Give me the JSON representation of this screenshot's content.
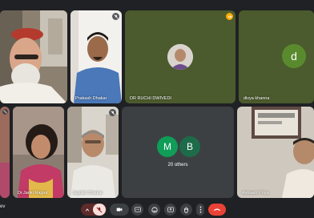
{
  "meeting": {
    "clock_partial": "ev"
  },
  "participants": [
    {
      "id": "p1",
      "name": ""
    },
    {
      "id": "p2",
      "name": "Prakash Dhakar"
    },
    {
      "id": "p3",
      "name": "DR RUCHI DWIVEDI"
    },
    {
      "id": "p4",
      "name": "divya khanna",
      "initial": "d"
    },
    {
      "id": "p5",
      "name": ""
    },
    {
      "id": "p6",
      "name": "Dr.Janki Rajput"
    },
    {
      "id": "p7",
      "name": "Jagdish Dhakar"
    },
    {
      "id": "p8",
      "name": "Avinash Priya"
    }
  ],
  "others_tile": {
    "initials": [
      "M",
      "B"
    ],
    "label": "20 others"
  },
  "colors": {
    "background": "#202124",
    "control_bg": "#3c4043",
    "end_call": "#ea4335",
    "avatar_green": "#0f9d58",
    "avatar_dark_green": "#1e6b4a",
    "tile_olive": "#4b5b2d",
    "divya_tile": "#5a8a2e"
  },
  "controls": [
    {
      "id": "mic-menu",
      "icon": "chevron-up-icon"
    },
    {
      "id": "mic",
      "icon": "mic-off-icon"
    },
    {
      "id": "camera",
      "icon": "camera-icon"
    },
    {
      "id": "captions",
      "icon": "captions-icon"
    },
    {
      "id": "emoji",
      "icon": "emoji-icon"
    },
    {
      "id": "present",
      "icon": "present-icon"
    },
    {
      "id": "raise-hand",
      "icon": "hand-icon"
    },
    {
      "id": "more",
      "icon": "more-vert-icon"
    },
    {
      "id": "end-call",
      "icon": "end-call-icon"
    }
  ]
}
